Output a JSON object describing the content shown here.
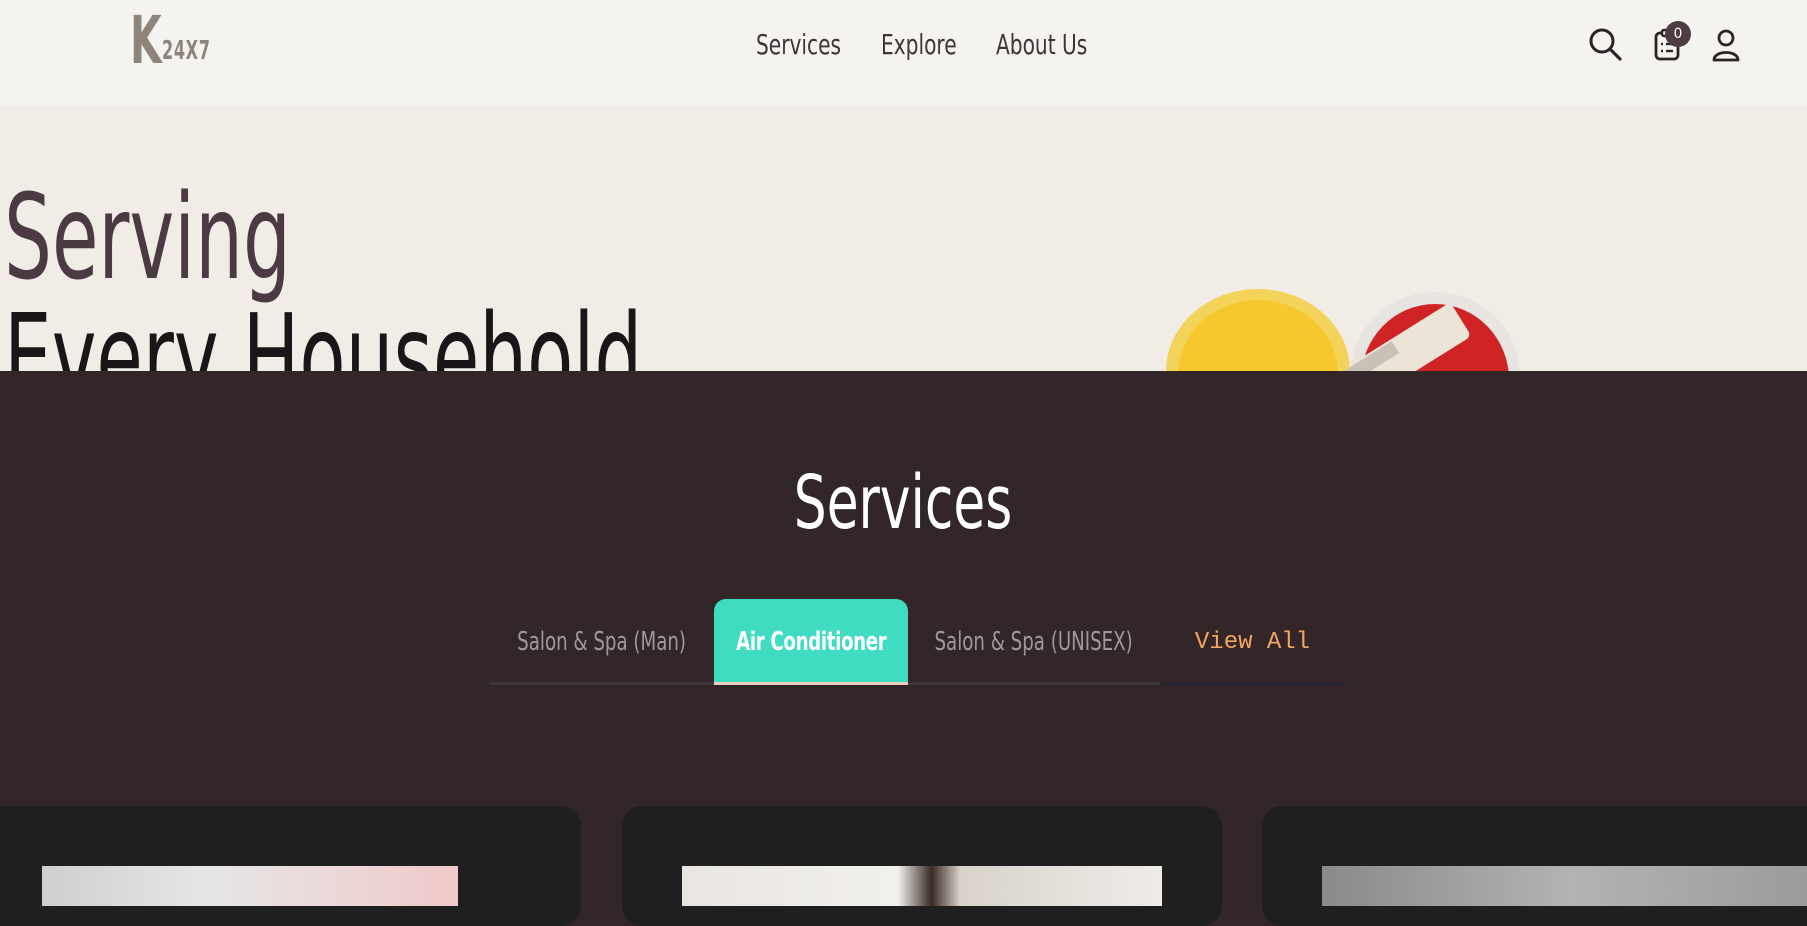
{
  "header": {
    "logo": {
      "letter": "K",
      "suffix": "24X7"
    },
    "nav": [
      "Services",
      "Explore",
      "About Us"
    ],
    "cart_count": "0",
    "icons": [
      "search-icon",
      "cart-clipboard-icon",
      "user-icon"
    ]
  },
  "hero": {
    "line1": "Serving",
    "line2": "Every Household"
  },
  "services": {
    "title": "Services",
    "tabs": [
      {
        "label": "Salon & Spa (Man)",
        "active": false
      },
      {
        "label": "Air Conditioner",
        "active": true
      },
      {
        "label": "Salon & Spa (UNISEX)",
        "active": false
      }
    ],
    "view_all": "View All"
  },
  "colors": {
    "header_bg": "#f5f3ef",
    "hero_bg": "#f1ece6",
    "section_bg": "#332629",
    "accent_teal": "#3fdcc2",
    "view_all": "#f0a65f",
    "card_bg": "#1f1f1f"
  }
}
